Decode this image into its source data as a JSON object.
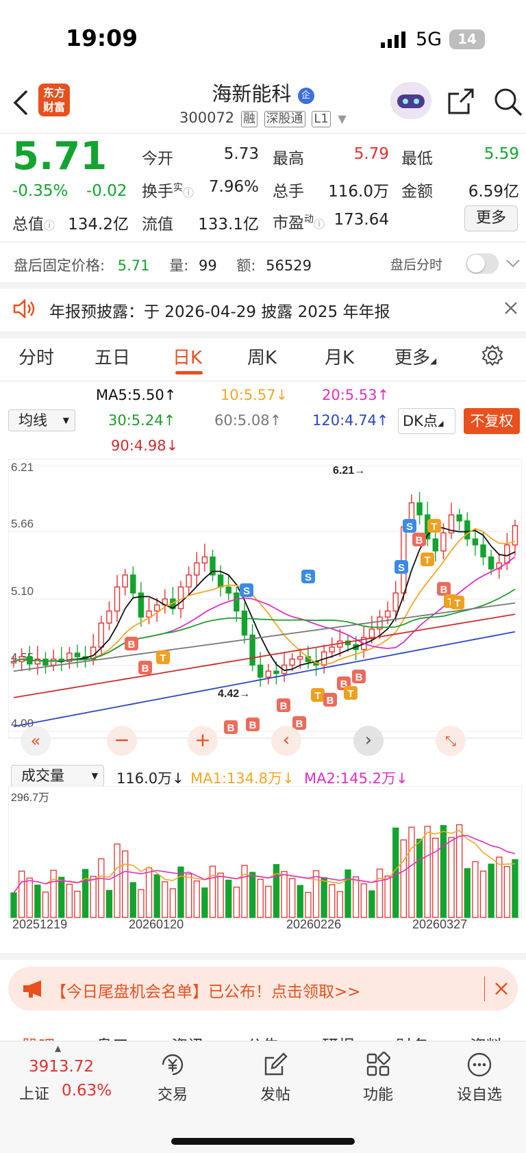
{
  "status": {
    "time": "19:09",
    "network": "5G",
    "battery": "14"
  },
  "header": {
    "logo_line1": "东方",
    "logo_line2": "财富",
    "stock_name": "海新能科",
    "stock_code": "300072",
    "tags": [
      "融",
      "深股通",
      "L1"
    ],
    "enterprise_badge": "企"
  },
  "quote": {
    "price": "5.71",
    "change_pct": "-0.35%",
    "change_amt": "-0.02",
    "open_label": "今开",
    "open": "5.73",
    "high_label": "最高",
    "high": "5.79",
    "low_label": "最低",
    "low": "5.59",
    "turnover_label": "换手",
    "turnover_sup": "实",
    "turnover": "7.96%",
    "volume_label": "总手",
    "volume": "116.0万",
    "amount_label": "金额",
    "amount": "6.59亿",
    "mktcap_label": "总值",
    "mktcap": "134.2亿",
    "float_label": "流值",
    "float": "133.1亿",
    "pe_label": "市盈",
    "pe_sup": "动",
    "pe": "173.64",
    "more_label": "更多"
  },
  "after_hours": {
    "price_label": "盘后固定价格:",
    "price": "5.71",
    "vol_label": "量:",
    "vol": "99",
    "amt_label": "额:",
    "amt": "56529",
    "toggle_label": "盘后分时",
    "toggle_on": false
  },
  "notice": {
    "text": "年报预披露：于 2026-04-29 披露 2025 年年报"
  },
  "tabs": [
    {
      "label": "分时",
      "active": false
    },
    {
      "label": "五日",
      "active": false
    },
    {
      "label": "日K",
      "active": true
    },
    {
      "label": "周K",
      "active": false
    },
    {
      "label": "月K",
      "active": false
    },
    {
      "label": "更多",
      "active": false
    }
  ],
  "indicators": {
    "ma_select": "均线",
    "ma5": "MA5:5.50",
    "ma10": "10:5.57",
    "ma20": "20:5.53",
    "ma30": "30:5.24",
    "ma60": "60:5.08",
    "ma120": "120:4.74",
    "ma90": "90:4.98",
    "dk_label": "DK点",
    "fuquan_label": "不复权",
    "colors": {
      "ma5": "#111111",
      "ma10": "#f5a623",
      "ma20": "#e02ec4",
      "ma30": "#1c9e2a",
      "ma60": "#777777",
      "ma120": "#2b46c8",
      "ma90": "#d22b2b"
    }
  },
  "chart_data": {
    "type": "candlestick",
    "y_ticks": [
      "6.21",
      "5.66",
      "5.10",
      "4.55",
      "4.00"
    ],
    "high_marker": "6.21",
    "low_marker": "4.42",
    "signals": [
      "B",
      "S",
      "T"
    ],
    "volume_panel": {
      "select_label": "成交量",
      "volume": "116.0万",
      "ma1": "MA1:134.8万",
      "ma2": "MA2:145.2万",
      "max_label": "296.7万"
    },
    "x_labels": [
      "20251219",
      "20260120",
      "20260226",
      "20260327"
    ]
  },
  "banner": {
    "text": "【今日尾盘机会名单】已公布！点击领取>>"
  },
  "bottom_tabs_partial": [
    "股吧",
    "盘口",
    "资讯",
    "公告",
    "研报",
    "财务",
    "资料"
  ],
  "bottom_bar": {
    "index_value": "3913.72",
    "index_name": "上证",
    "index_change": "0.63%",
    "items": [
      "交易",
      "发帖",
      "功能",
      "设自选"
    ]
  }
}
